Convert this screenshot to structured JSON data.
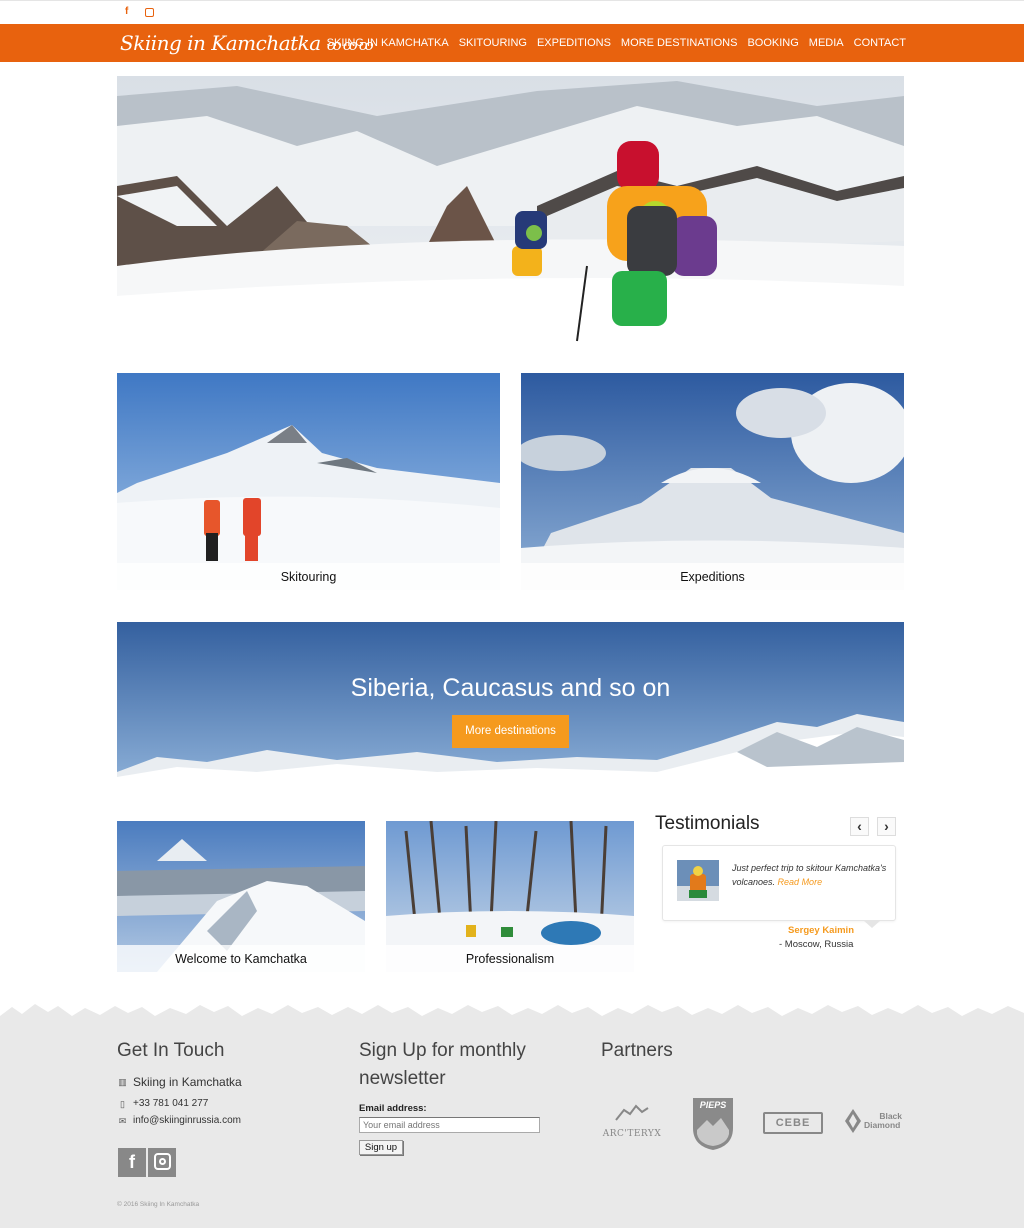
{
  "topbar": {
    "facebook_icon": "f",
    "instagram_icon": "◙"
  },
  "header": {
    "logo_text": "Skiing in Kamchatka",
    "nav": [
      "SKIING IN KAMCHATKA",
      "SKITOURING",
      "EXPEDITIONS",
      "MORE DESTINATIONS",
      "BOOKING",
      "MEDIA",
      "CONTACT"
    ]
  },
  "tiles": {
    "skitouring": "Skitouring",
    "expeditions": "Expeditions",
    "welcome": "Welcome to Kamchatka",
    "professionalism": "Professionalism"
  },
  "banner": {
    "title": "Siberia, Caucasus and so on",
    "button": "More destinations"
  },
  "testimonials": {
    "title": "Testimonials",
    "prev": "‹",
    "next": "›",
    "quote": "Just perfect trip to skitour Kamchatka's volcanoes.",
    "read_more": "Read More",
    "author": "Sergey Kaimin",
    "location": "- Moscow, Russia"
  },
  "footer": {
    "contact": {
      "title": "Get In Touch",
      "company": "Skiing in Kamchatka",
      "phone": "+33 781 041 277",
      "email": "info@skiinginrussia.com"
    },
    "newsletter": {
      "title": "Sign Up for monthly newsletter",
      "label": "Email address:",
      "placeholder": "Your email address",
      "button": "Sign up"
    },
    "partners": {
      "title": "Partners",
      "arcteryx": "ARC'TERYX",
      "pieps": "PIEPS",
      "cebe": "CEBE",
      "black_diamond_1": "Black",
      "black_diamond_2": "Diamond"
    },
    "copyright": "© 2016 Skiing In Kamchatka"
  },
  "colors": {
    "brand": "#e8620e",
    "accent": "#f59a1e",
    "footer_bg": "#e9e9e9"
  }
}
